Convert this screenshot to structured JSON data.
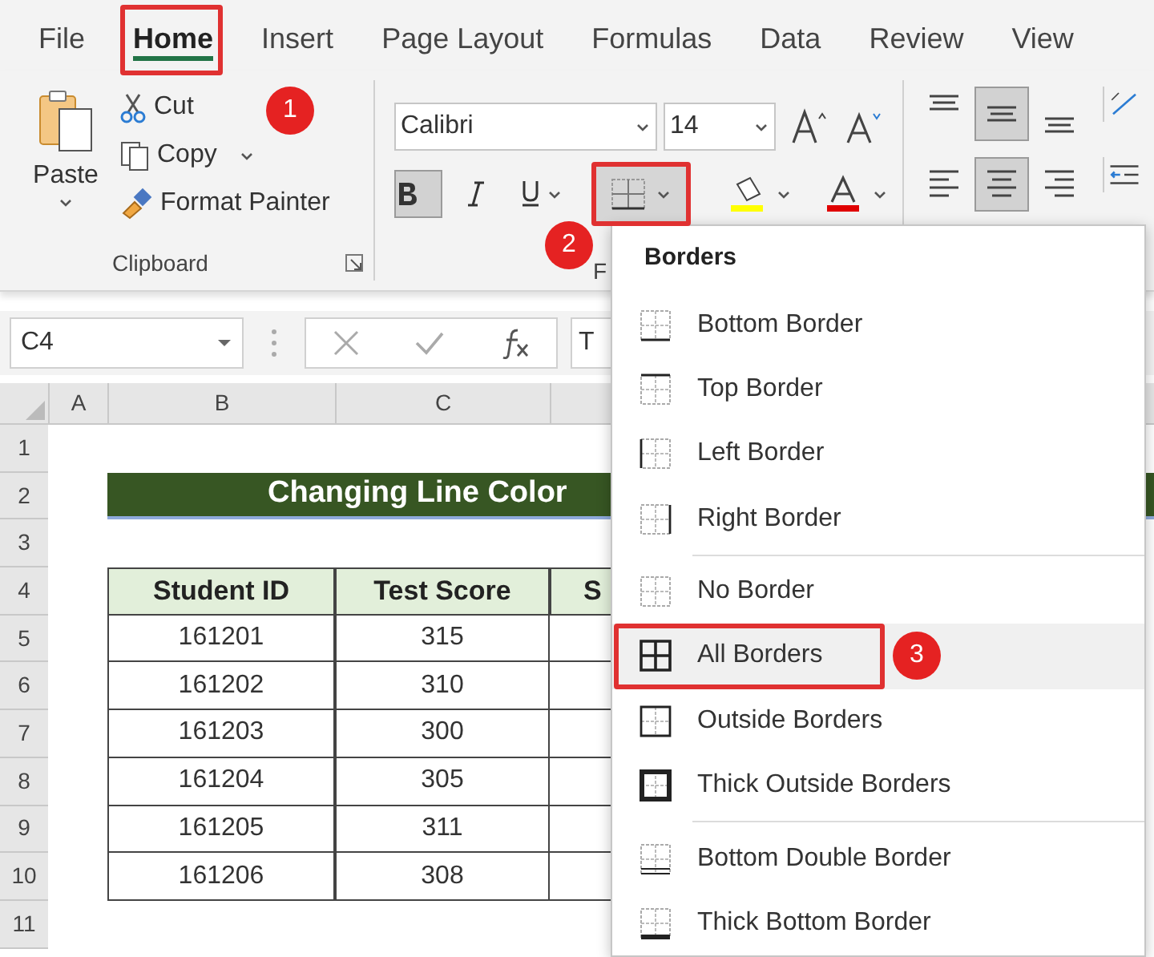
{
  "ribbon_tabs": [
    {
      "label": "File",
      "selected": false
    },
    {
      "label": "Home",
      "selected": true
    },
    {
      "label": "Insert",
      "selected": false
    },
    {
      "label": "Page Layout",
      "selected": false
    },
    {
      "label": "Formulas",
      "selected": false
    },
    {
      "label": "Data",
      "selected": false
    },
    {
      "label": "Review",
      "selected": false
    },
    {
      "label": "View",
      "selected": false
    }
  ],
  "clipboard": {
    "paste": "Paste",
    "cut": "Cut",
    "copy": "Copy",
    "format_painter": "Format Painter",
    "group_label": "Clipboard"
  },
  "font": {
    "name": "Calibri",
    "size": "14",
    "bold": true,
    "group_label": "F"
  },
  "vertical_align": [
    {
      "kind": "top",
      "selected": false
    },
    {
      "kind": "middle",
      "selected": true
    },
    {
      "kind": "bottom",
      "selected": false
    }
  ],
  "horizontal_align": [
    {
      "kind": "left",
      "selected": false
    },
    {
      "kind": "center",
      "selected": true
    },
    {
      "kind": "right",
      "selected": false
    }
  ],
  "name_box": "C4",
  "formula_value": "T",
  "columns": [
    "A",
    "B",
    "C"
  ],
  "row_numbers": [
    "1",
    "2",
    "3",
    "4",
    "5",
    "6",
    "7",
    "8",
    "9",
    "10",
    "11"
  ],
  "sheet_title": "Changing Line Color",
  "table": {
    "headers": [
      "Student ID",
      "Test Score",
      "S"
    ],
    "rows": [
      [
        "161201",
        "315"
      ],
      [
        "161202",
        "310"
      ],
      [
        "161203",
        "300"
      ],
      [
        "161204",
        "305"
      ],
      [
        "161205",
        "311"
      ],
      [
        "161206",
        "308"
      ]
    ]
  },
  "borders_menu": {
    "title": "Borders",
    "items": [
      {
        "label": "Bottom Border",
        "kind": "bottom",
        "selected": false
      },
      {
        "label": "Top Border",
        "kind": "top",
        "selected": false
      },
      {
        "label": "Left Border",
        "kind": "left",
        "selected": false
      },
      {
        "label": "Right Border",
        "kind": "right",
        "selected": false
      },
      {
        "label": "No Border",
        "kind": "none",
        "selected": false
      },
      {
        "label": "All Borders",
        "kind": "all",
        "selected": true
      },
      {
        "label": "Outside Borders",
        "kind": "outside",
        "selected": false
      },
      {
        "label": "Thick Outside Borders",
        "kind": "thick_outside",
        "selected": false
      },
      {
        "label": "Bottom Double Border",
        "kind": "bottom_double",
        "selected": false
      },
      {
        "label": "Thick Bottom Border",
        "kind": "thick_bottom",
        "selected": false
      }
    ]
  },
  "callouts": [
    "1",
    "2",
    "3"
  ]
}
